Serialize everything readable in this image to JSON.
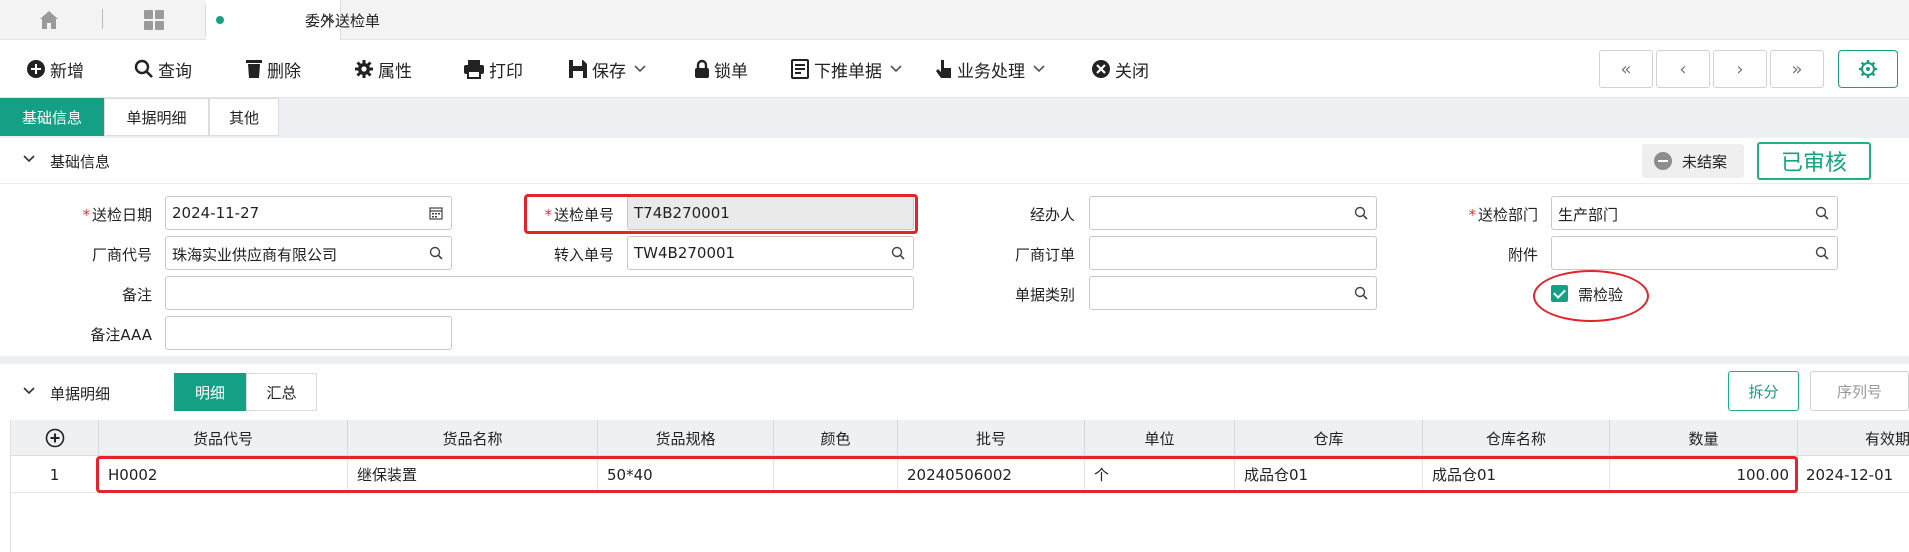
{
  "tabbar": {
    "doc_tab_label": "委外送检单",
    "close_glyph": "×"
  },
  "toolbar": {
    "new": "新增",
    "query": "查询",
    "delete": "删除",
    "properties": "属性",
    "print": "打印",
    "save": "保存",
    "lock": "锁单",
    "push_down": "下推单据",
    "business": "业务处理",
    "close": "关闭",
    "nav_first": "«",
    "nav_prev": "‹",
    "nav_next": "›",
    "nav_last": "»"
  },
  "section_tabs": [
    "基础信息",
    "单据明细",
    "其他"
  ],
  "basic": {
    "title": "基础信息",
    "status_pill": "未结案",
    "audit_badge": "已审核"
  },
  "form": {
    "inspect_date_label": "送检日期",
    "inspect_date": "2024-11-27",
    "inspect_no_label": "送检单号",
    "inspect_no": "T74B270001",
    "handler_label": "经办人",
    "handler": "",
    "dept_label": "送检部门",
    "dept": "生产部门",
    "vendor_label": "厂商代号",
    "vendor": "珠海实业供应商有限公司",
    "transfer_no_label": "转入单号",
    "transfer_no": "TW4B270001",
    "vendor_order_label": "厂商订单",
    "vendor_order": "",
    "attachment_label": "附件",
    "attachment": "",
    "remark_label": "备注",
    "remark": "",
    "doc_type_label": "单据类别",
    "doc_type": "",
    "need_inspect_label": "需检验",
    "need_inspect": true,
    "remark_aaa_label": "备注AAA",
    "remark_aaa": ""
  },
  "detail": {
    "title": "单据明细",
    "tab_detail": "明细",
    "tab_summary": "汇总",
    "split_btn": "拆分",
    "serial_btn": "序列号",
    "add_glyph": "+",
    "columns": [
      "货品代号",
      "货品名称",
      "货品规格",
      "颜色",
      "批号",
      "单位",
      "仓库",
      "仓库名称",
      "数量",
      "有效期"
    ],
    "rows": [
      {
        "index": "1",
        "code": "H0002",
        "name": "继保装置",
        "spec": "50*40",
        "color": "",
        "batch": "20240506002",
        "unit": "个",
        "warehouse": "成品仓01",
        "warehouse_name": "成品仓01",
        "qty": "100.00",
        "expiry": "2024-12-01"
      }
    ]
  },
  "colors": {
    "accent": "#14a085",
    "highlight": "#e3242b",
    "required": "#e33333"
  }
}
